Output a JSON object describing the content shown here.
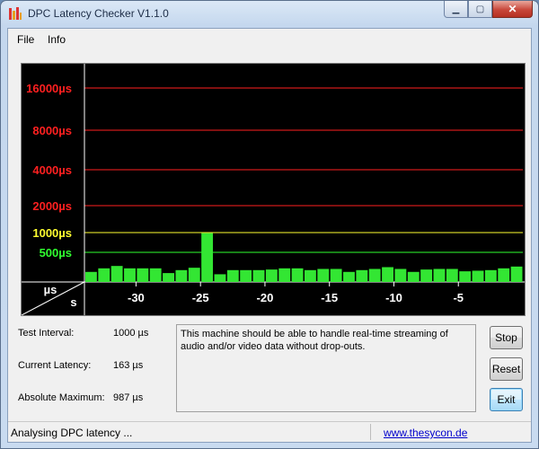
{
  "window": {
    "title": "DPC Latency Checker V1.1.0",
    "controls": {
      "minimize": "▁",
      "maximize": "▢",
      "close": "✕"
    }
  },
  "menu": {
    "items": [
      "File",
      "Info"
    ]
  },
  "chart_data": {
    "type": "bar",
    "y_axis_unit_label": "µs",
    "x_axis_unit_label": "s",
    "y_levels": [
      {
        "label": "16000µs",
        "value": 16000,
        "color": "#ff2020"
      },
      {
        "label": "8000µs",
        "value": 8000,
        "color": "#ff2020"
      },
      {
        "label": "4000µs",
        "value": 4000,
        "color": "#ff2020"
      },
      {
        "label": "2000µs",
        "value": 2000,
        "color": "#ff2020"
      },
      {
        "label": "1000µs",
        "value": 1000,
        "color": "#ffff30"
      },
      {
        "label": "500µs",
        "value": 500,
        "color": "#30ff30"
      }
    ],
    "x_ticks": [
      "-30",
      "-25",
      "-20",
      "-15",
      "-10",
      "-5"
    ],
    "x_tick_values": [
      -30,
      -25,
      -20,
      -15,
      -10,
      -5
    ],
    "x_range": [
      -34,
      0
    ],
    "bar_color": "#33e633",
    "values_us": [
      170,
      230,
      270,
      230,
      230,
      230,
      150,
      200,
      240,
      987,
      130,
      200,
      200,
      200,
      210,
      230,
      230,
      200,
      220,
      220,
      170,
      200,
      220,
      250,
      220,
      170,
      210,
      220,
      220,
      180,
      190,
      200,
      230,
      260
    ]
  },
  "stats": {
    "test_interval": {
      "label": "Test Interval:",
      "value": "1000 µs"
    },
    "current_latency": {
      "label": "Current Latency:",
      "value": "163 µs"
    },
    "absolute_maximum": {
      "label": "Absolute Maximum:",
      "value": "987 µs"
    }
  },
  "message": "This machine should be able to handle real-time streaming of audio and/or video data without drop-outs.",
  "buttons": {
    "stop": "Stop",
    "reset": "Reset",
    "exit": "Exit"
  },
  "status": {
    "text": "Analysing DPC latency ...",
    "link": "www.thesycon.de"
  }
}
